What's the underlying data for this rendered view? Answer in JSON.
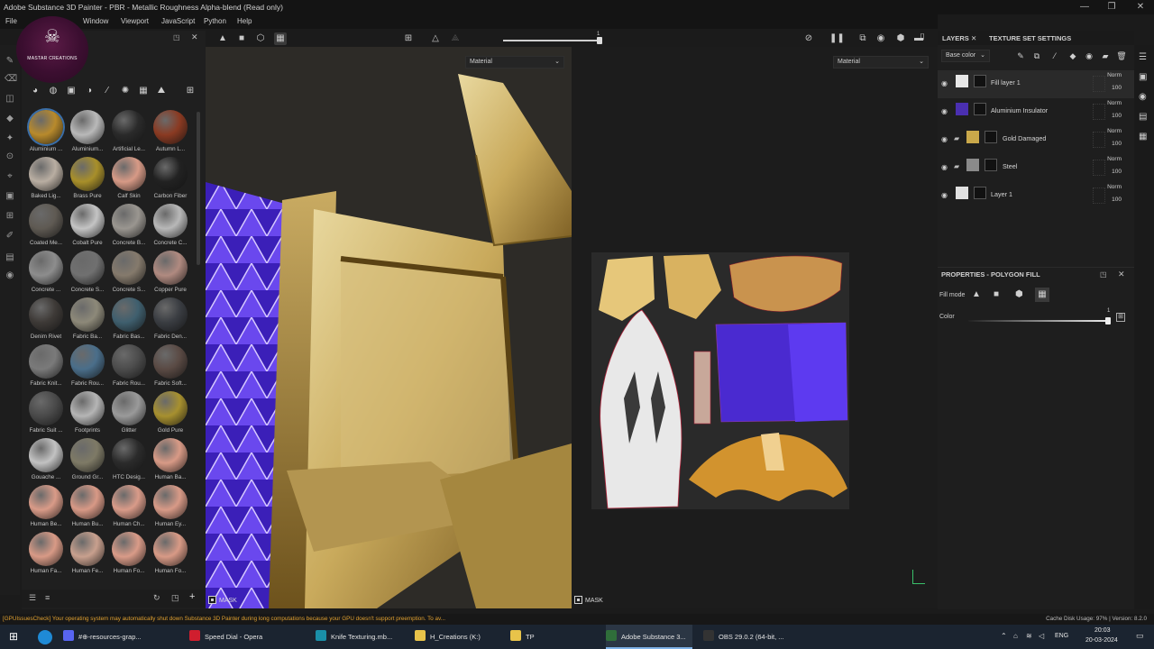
{
  "window": {
    "title": "Adobe Substance 3D Painter - PBR - Metallic Roughness Alpha-blend (Read only)",
    "controls": [
      "—",
      "❐",
      "✕"
    ]
  },
  "menu": [
    "File",
    "Window",
    "Viewport",
    "JavaScript",
    "Python",
    "Help"
  ],
  "logo": {
    "text": "MASTAR CREATIONS"
  },
  "shelf": {
    "materials": [
      {
        "label": "Aluminium ...",
        "color": "#b88a2c"
      },
      {
        "label": "Aluminium...",
        "color": "#b9b9b9"
      },
      {
        "label": "Artificial Le...",
        "color": "#2a2a2a"
      },
      {
        "label": "Autumn L...",
        "color": "#8a3a22"
      },
      {
        "label": "Baked Lig...",
        "color": "#b9aea2"
      },
      {
        "label": "Brass Pure",
        "color": "#a88f2a"
      },
      {
        "label": "Calf Skin",
        "color": "#d79a86"
      },
      {
        "label": "Carbon Fiber",
        "color": "#222222"
      },
      {
        "label": "Coated Me...",
        "color": "#5f5a53"
      },
      {
        "label": "Cobalt Pure",
        "color": "#c4c4c4"
      },
      {
        "label": "Concrete B...",
        "color": "#9a9690"
      },
      {
        "label": "Concrete C...",
        "color": "#b8b8b8"
      },
      {
        "label": "Concrete ...",
        "color": "#8d8d8d"
      },
      {
        "label": "Concrete S...",
        "color": "#707070"
      },
      {
        "label": "Concrete S...",
        "color": "#857a6c"
      },
      {
        "label": "Copper Pure",
        "color": "#b08a80"
      },
      {
        "label": "Denim Rivet",
        "color": "#3e3a37"
      },
      {
        "label": "Fabric Ba...",
        "color": "#8d8979"
      },
      {
        "label": "Fabric Bas...",
        "color": "#3f5f6e"
      },
      {
        "label": "Fabric Den...",
        "color": "#3a3d42"
      },
      {
        "label": "Fabric Knit...",
        "color": "#7a7a7a"
      },
      {
        "label": "Fabric Rou...",
        "color": "#4a6e8a"
      },
      {
        "label": "Fabric Rou...",
        "color": "#4c4c4c"
      },
      {
        "label": "Fabric Soft...",
        "color": "#5a4a44"
      },
      {
        "label": "Fabric Suit ...",
        "color": "#4a4a4a"
      },
      {
        "label": "Footprints",
        "color": "#b5b5b5"
      },
      {
        "label": "Glitter",
        "color": "#9a9a9a"
      },
      {
        "label": "Gold Pure",
        "color": "#a7902f"
      },
      {
        "label": "Gouache ...",
        "color": "#c2c2c2"
      },
      {
        "label": "Ground Gr...",
        "color": "#7e7a66"
      },
      {
        "label": "HTC Desig...",
        "color": "#2b2b2b"
      },
      {
        "label": "Human Ba...",
        "color": "#d89a86"
      },
      {
        "label": "Human Be...",
        "color": "#d99b88"
      },
      {
        "label": "Human Bu...",
        "color": "#d89986"
      },
      {
        "label": "Human Ch...",
        "color": "#d99b89"
      },
      {
        "label": "Human Ey...",
        "color": "#d89a87"
      },
      {
        "label": "Human Fa...",
        "color": "#d89a86"
      },
      {
        "label": "Human Fe...",
        "color": "#c8a08e"
      },
      {
        "label": "Human Fo...",
        "color": "#d99b88"
      },
      {
        "label": "Human Fo...",
        "color": "#d89a86"
      }
    ]
  },
  "viewport": {
    "slider_value": "1",
    "left_dropdown": "Material",
    "right_dropdown": "Material",
    "mask_left": "MASK",
    "mask_right": "MASK"
  },
  "layers_panel": {
    "tab_layers": "LAYERS",
    "tab_close": "✕",
    "tab_texture": "TEXTURE SET SETTINGS",
    "channel_dropdown": "Base color",
    "layers": [
      {
        "name": "Fill layer 1",
        "blend": "Norm",
        "opacity": "100",
        "selected": true,
        "thumb_color": "#e8e8e8"
      },
      {
        "name": "Aluminium Insulator",
        "blend": "Norm",
        "opacity": "100",
        "selected": false,
        "thumb_color": "#4a2fb0"
      },
      {
        "name": "Gold Damaged",
        "blend": "Norm",
        "opacity": "100",
        "selected": false,
        "thumb_color": "#c9a84a"
      },
      {
        "name": "Steel",
        "blend": "Norm",
        "opacity": "100",
        "selected": false,
        "thumb_color": "#8a8a8a"
      },
      {
        "name": "Layer 1",
        "blend": "Norm",
        "opacity": "100",
        "selected": false,
        "thumb_color": "#e0e0e0"
      }
    ]
  },
  "properties": {
    "title": "PROPERTIES - POLYGON FILL",
    "fill_mode_label": "Fill mode",
    "color_label": "Color",
    "color_value": "1"
  },
  "status": {
    "message": "[GPUIssuesCheck] Your operating system may automatically shut down Substance 3D Painter during long computations because your GPU doesn't support preemption. To av...",
    "right": "Cache Disk Usage:  97% | Version: 8.2.0"
  },
  "taskbar": {
    "items": [
      {
        "label": "#⊕-resources-grap...",
        "color": "#5865f2"
      },
      {
        "label": "Speed Dial - Opera",
        "color": "#d01e2e"
      },
      {
        "label": "Knife Texturing.mb...",
        "color": "#1a8fa8"
      },
      {
        "label": "H_Creations (K:)",
        "color": "#e8c34a"
      },
      {
        "label": "TP",
        "color": "#e8c34a"
      },
      {
        "label": "Adobe Substance 3...",
        "color": "#2f6e3a"
      },
      {
        "label": "OBS 29.0.2 (64-bit, ...",
        "color": "#333333"
      }
    ],
    "lang": "ENG",
    "time": "20:03",
    "date": "20-03-2024"
  }
}
